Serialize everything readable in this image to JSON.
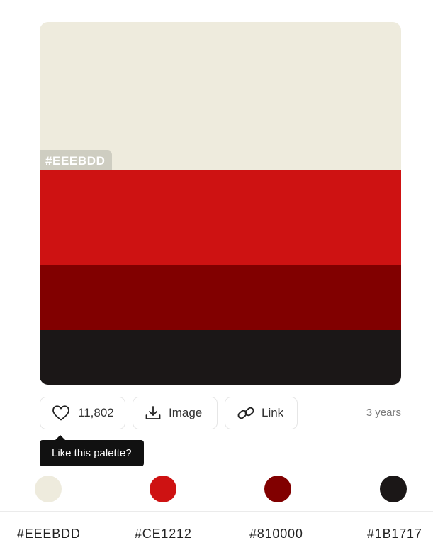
{
  "palette": {
    "colors": [
      {
        "hex": "#EEEBDD",
        "color": "#EEEBDD"
      },
      {
        "hex": "#CE1212",
        "color": "#CE1212"
      },
      {
        "hex": "#810000",
        "color": "#810000"
      },
      {
        "hex": "#1B1717",
        "color": "#1B1717"
      }
    ],
    "hovered_label": "#EEEBDD"
  },
  "actions": {
    "likes": "11,802",
    "image_label": "Image",
    "link_label": "Link",
    "age": "3 years"
  },
  "tooltip": {
    "text": "Like this palette?"
  },
  "icons": [
    "heart-icon",
    "download-icon",
    "link-icon"
  ]
}
